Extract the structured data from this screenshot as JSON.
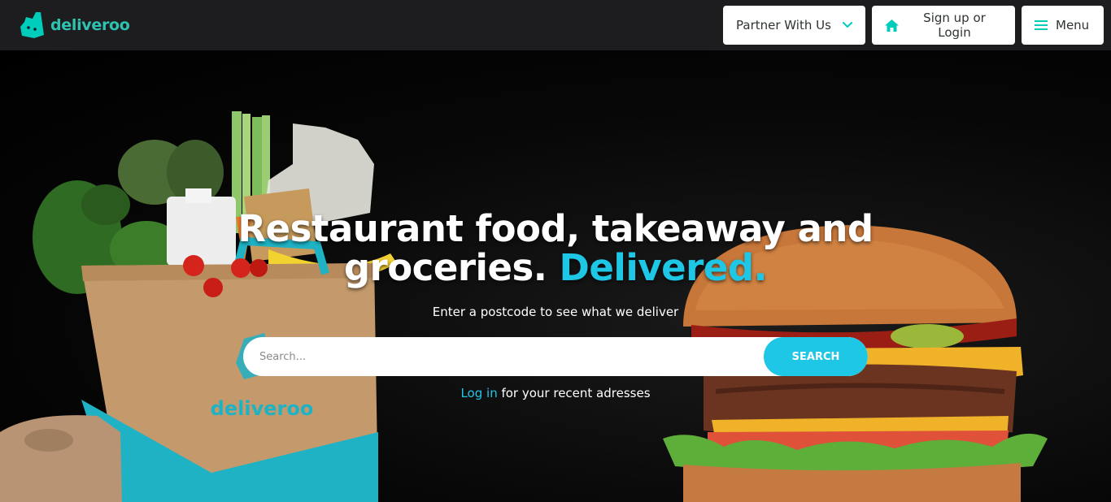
{
  "brand": {
    "name": "deliveroo",
    "accent_color": "#00ccbc",
    "logo_icon": "kangaroo-logo-icon"
  },
  "nav": {
    "partner_label": "Partner With Us",
    "partner_icon": "chevron-down-icon",
    "login_label": "Sign up or Login",
    "login_icon": "home-icon",
    "menu_label": "Menu",
    "menu_icon": "hamburger-icon"
  },
  "hero": {
    "headline_line1": "Restaurant food, takeaway and",
    "headline_line2": "groceries.",
    "headline_accent": "Delivered.",
    "accent_color": "#1ec7e6",
    "subline": "Enter a postcode to see what we deliver",
    "search_placeholder": "Search...",
    "search_button": "SEARCH",
    "login_link": "Log in",
    "recent_text": " for your recent adresses",
    "bag_brand": "deliveroo"
  }
}
